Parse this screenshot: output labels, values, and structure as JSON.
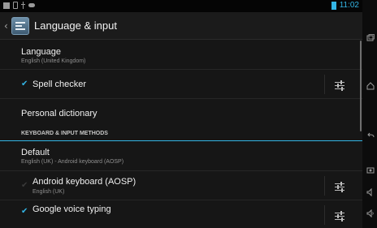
{
  "status_bar": {
    "time": "11:02",
    "battery_color": "#33b5e5",
    "left_icons": [
      "gallery-icon",
      "screenshot-icon",
      "usb-icon",
      "game-controller-icon"
    ]
  },
  "action_bar": {
    "title": "Language & input",
    "icon": "settings-app-icon"
  },
  "list": {
    "language": {
      "title": "Language",
      "summary": "English (United Kingdom)"
    },
    "spell_checker": {
      "title": "Spell checker",
      "checked": true
    },
    "personal_dictionary": {
      "title": "Personal dictionary"
    },
    "section_header": "KEYBOARD & INPUT METHODS",
    "default": {
      "title": "Default",
      "summary": "English (UK) - Android keyboard (AOSP)"
    },
    "android_keyboard": {
      "title": "Android keyboard (AOSP)",
      "summary": "English (UK)",
      "checked": false
    },
    "google_voice": {
      "title": "Google voice typing",
      "checked": true
    }
  },
  "colors": {
    "accent": "#33b5e5",
    "background": "#161616"
  },
  "nav_icons": [
    "recent-apps-icon",
    "home-icon",
    "back-icon",
    "screenshot-nav-icon",
    "volume-down-icon",
    "volume-up-icon"
  ]
}
